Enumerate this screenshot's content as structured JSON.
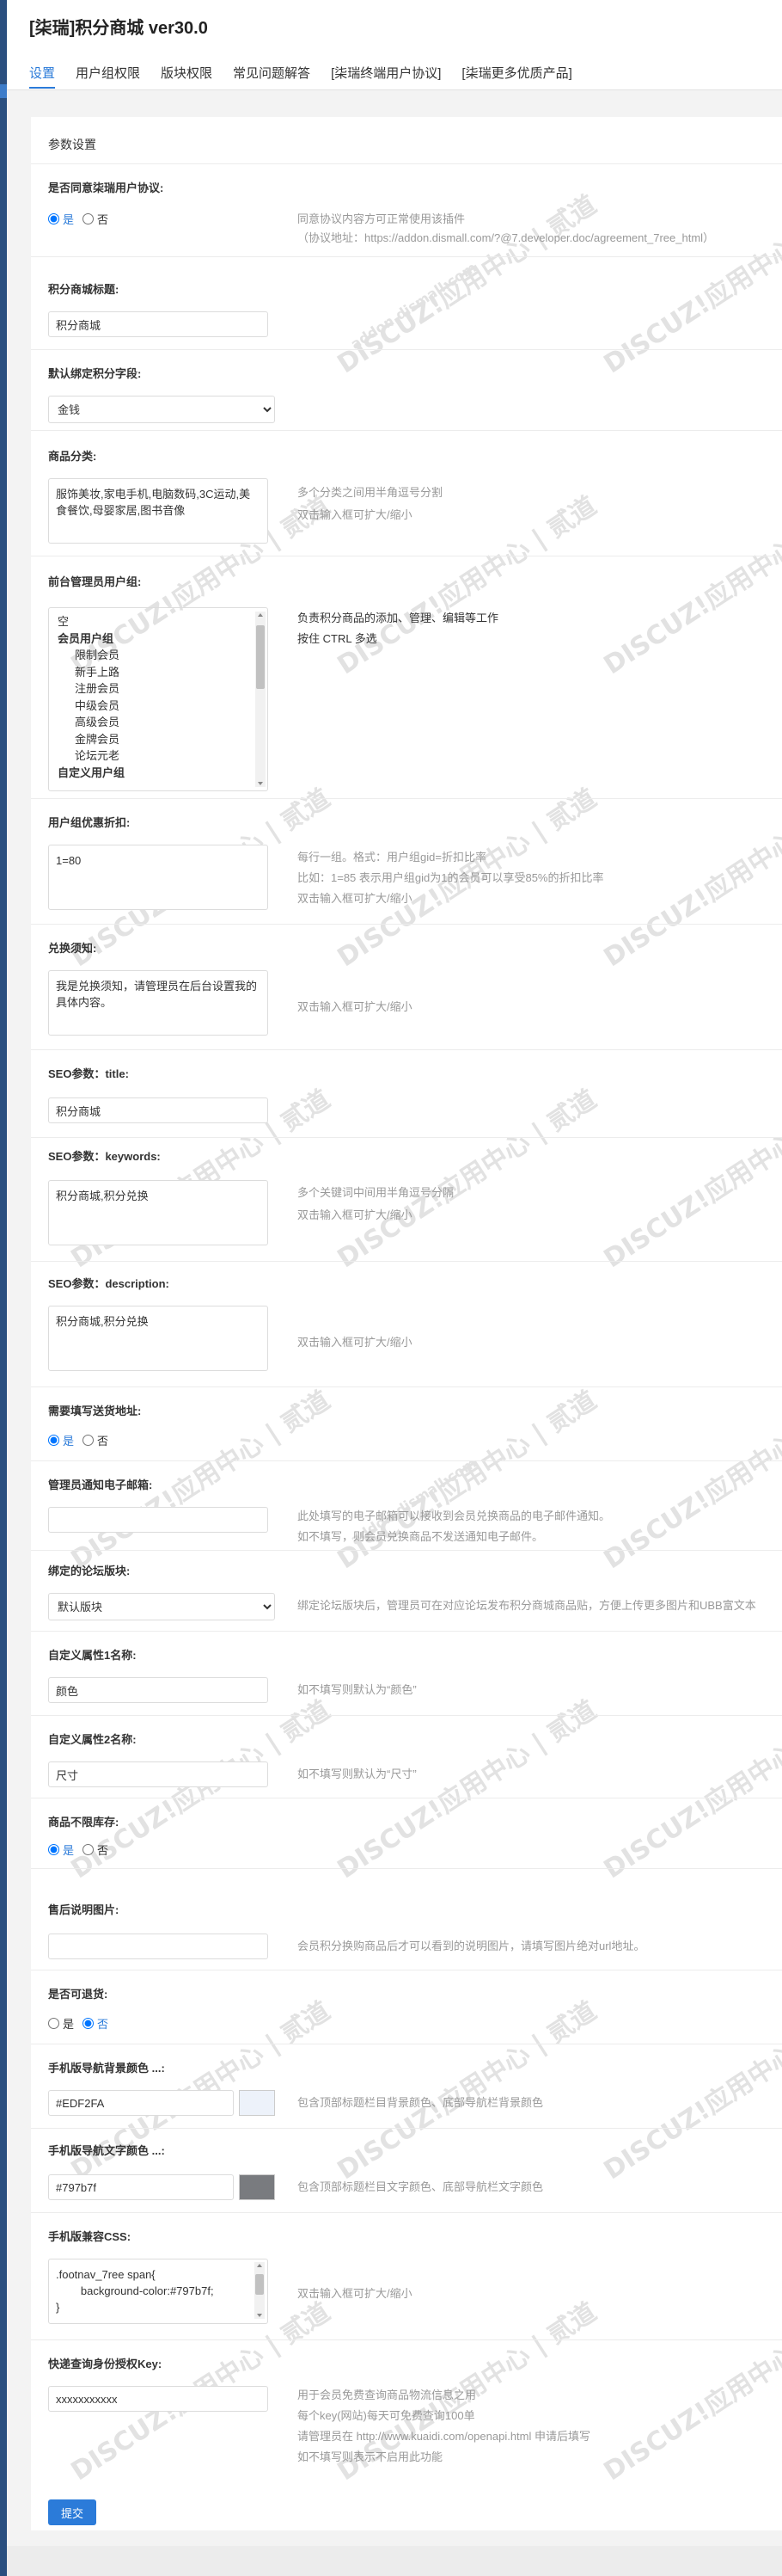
{
  "app": {
    "title": "[柒瑞]积分商城 ver30.0"
  },
  "tabs": [
    "设置",
    "用户组权限",
    "版块权限",
    "常见问题解答",
    "[柒瑞终端用户协议]",
    "[柒瑞更多优质产品]"
  ],
  "panel": {
    "title": "参数设置"
  },
  "options": {
    "yes": "是",
    "no": "否"
  },
  "f1": {
    "label": "是否同意柒瑞用户协议:",
    "tip1": "同意协议内容方可正常使用该插件",
    "tip2": "（协议地址：https://addon.dismall.com/?@7.developer.doc/agreement_7ree_html）"
  },
  "f2": {
    "label": "积分商城标题:",
    "value": "积分商城"
  },
  "f3": {
    "label": "默认绑定积分字段:",
    "selected": "金钱"
  },
  "f4": {
    "label": "商品分类:",
    "value": "服饰美妆,家电手机,电脑数码,3C运动,美食餐饮,母婴家居,图书音像",
    "tip1": "多个分类之间用半角逗号分割",
    "tip2": "双击输入框可扩大/缩小"
  },
  "f5": {
    "label": "前台管理员用户组:",
    "tip1": "负责积分商品的添加、管理、编辑等工作",
    "tip2": "按住 CTRL 多选",
    "list": [
      {
        "text": "空",
        "kind": "plain"
      },
      {
        "text": "会员用户组",
        "kind": "grp"
      },
      {
        "text": "限制会员",
        "kind": "sub"
      },
      {
        "text": "新手上路",
        "kind": "sub"
      },
      {
        "text": "注册会员",
        "kind": "sub"
      },
      {
        "text": "中级会员",
        "kind": "sub"
      },
      {
        "text": "高级会员",
        "kind": "sub"
      },
      {
        "text": "金牌会员",
        "kind": "sub"
      },
      {
        "text": "论坛元老",
        "kind": "sub"
      },
      {
        "text": "自定义用户组",
        "kind": "grp"
      }
    ]
  },
  "f6": {
    "label": "用户组优惠折扣:",
    "value": "1=80",
    "tip1": "每行一组。格式：用户组gid=折扣比率",
    "tip2": "比如：1=85 表示用户组gid为1的会员可以享受85%的折扣比率",
    "tip3": "双击输入框可扩大/缩小"
  },
  "f7": {
    "label": "兑换须知:",
    "value": "我是兑换须知，请管理员在后台设置我的具体内容。",
    "tip1": "双击输入框可扩大/缩小"
  },
  "f8": {
    "label": "SEO参数：title:",
    "value": "积分商城"
  },
  "f9": {
    "label": "SEO参数：keywords:",
    "value": "积分商城,积分兑换",
    "tip1": "多个关键词中间用半角逗号分隔",
    "tip2": "双击输入框可扩大/缩小"
  },
  "f10": {
    "label": "SEO参数：description:",
    "value": "积分商城,积分兑换",
    "tip1": "双击输入框可扩大/缩小"
  },
  "f11": {
    "label": "需要填写送货地址:"
  },
  "f12": {
    "label": "管理员通知电子邮箱:",
    "value": "",
    "tip1": "此处填写的电子邮箱可以接收到会员兑换商品的电子邮件通知。",
    "tip2": "如不填写，则会员兑换商品不发送通知电子邮件。"
  },
  "f13": {
    "label": "绑定的论坛版块:",
    "selected": "默认版块",
    "tip1": "绑定论坛版块后，管理员可在对应论坛发布积分商城商品贴，方便上传更多图片和UBB富文本"
  },
  "f14": {
    "label": "自定义属性1名称:",
    "value": "颜色",
    "tip1": "如不填写则默认为“颜色”"
  },
  "f15": {
    "label": "自定义属性2名称:",
    "value": "尺寸",
    "tip1": "如不填写则默认为“尺寸”"
  },
  "f16": {
    "label": "商品不限库存:"
  },
  "f17": {
    "label": "售后说明图片:",
    "value": "",
    "tip1": "会员积分换购商品后才可以看到的说明图片，请填写图片绝对url地址。"
  },
  "f18": {
    "label": "是否可退货:"
  },
  "f19": {
    "label": "手机版导航背景颜色 ...:",
    "value": "#EDF2FA",
    "tip1": "包含顶部标题栏目背景颜色、底部导航栏背景颜色",
    "color": "#EDF2FA"
  },
  "f20": {
    "label": "手机版导航文字颜色 ...:",
    "value": "#797b7f",
    "tip1": "包含顶部标题栏目文字颜色、底部导航栏文字颜色",
    "color": "#797b7f"
  },
  "f21": {
    "label": "手机版兼容CSS:",
    "value": ".footnav_7ree span{\n        background-color:#797b7f;\n}",
    "tip1": "双击输入框可扩大/缩小"
  },
  "f22": {
    "label": "快递查询身份授权Key:",
    "value": "xxxxxxxxxxx",
    "tip1": "用于会员免费查询商品物流信息之用",
    "tip2": "每个key(网站)每天可免费查询100单",
    "tip3": "请管理员在 http://www.kuaidi.com/openapi.html 申请后填写",
    "tip4": "如不填写则表示不启用此功能"
  },
  "submit": {
    "label": "提交"
  },
  "watermark": {
    "text": "DISCUZ!应用中心 | 贰道",
    "sub": "addon.dismall.com"
  },
  "colors": {
    "accent": "#2b7bd9",
    "sidebar": "#2a4f7f",
    "header_bg": "#ffffff"
  }
}
